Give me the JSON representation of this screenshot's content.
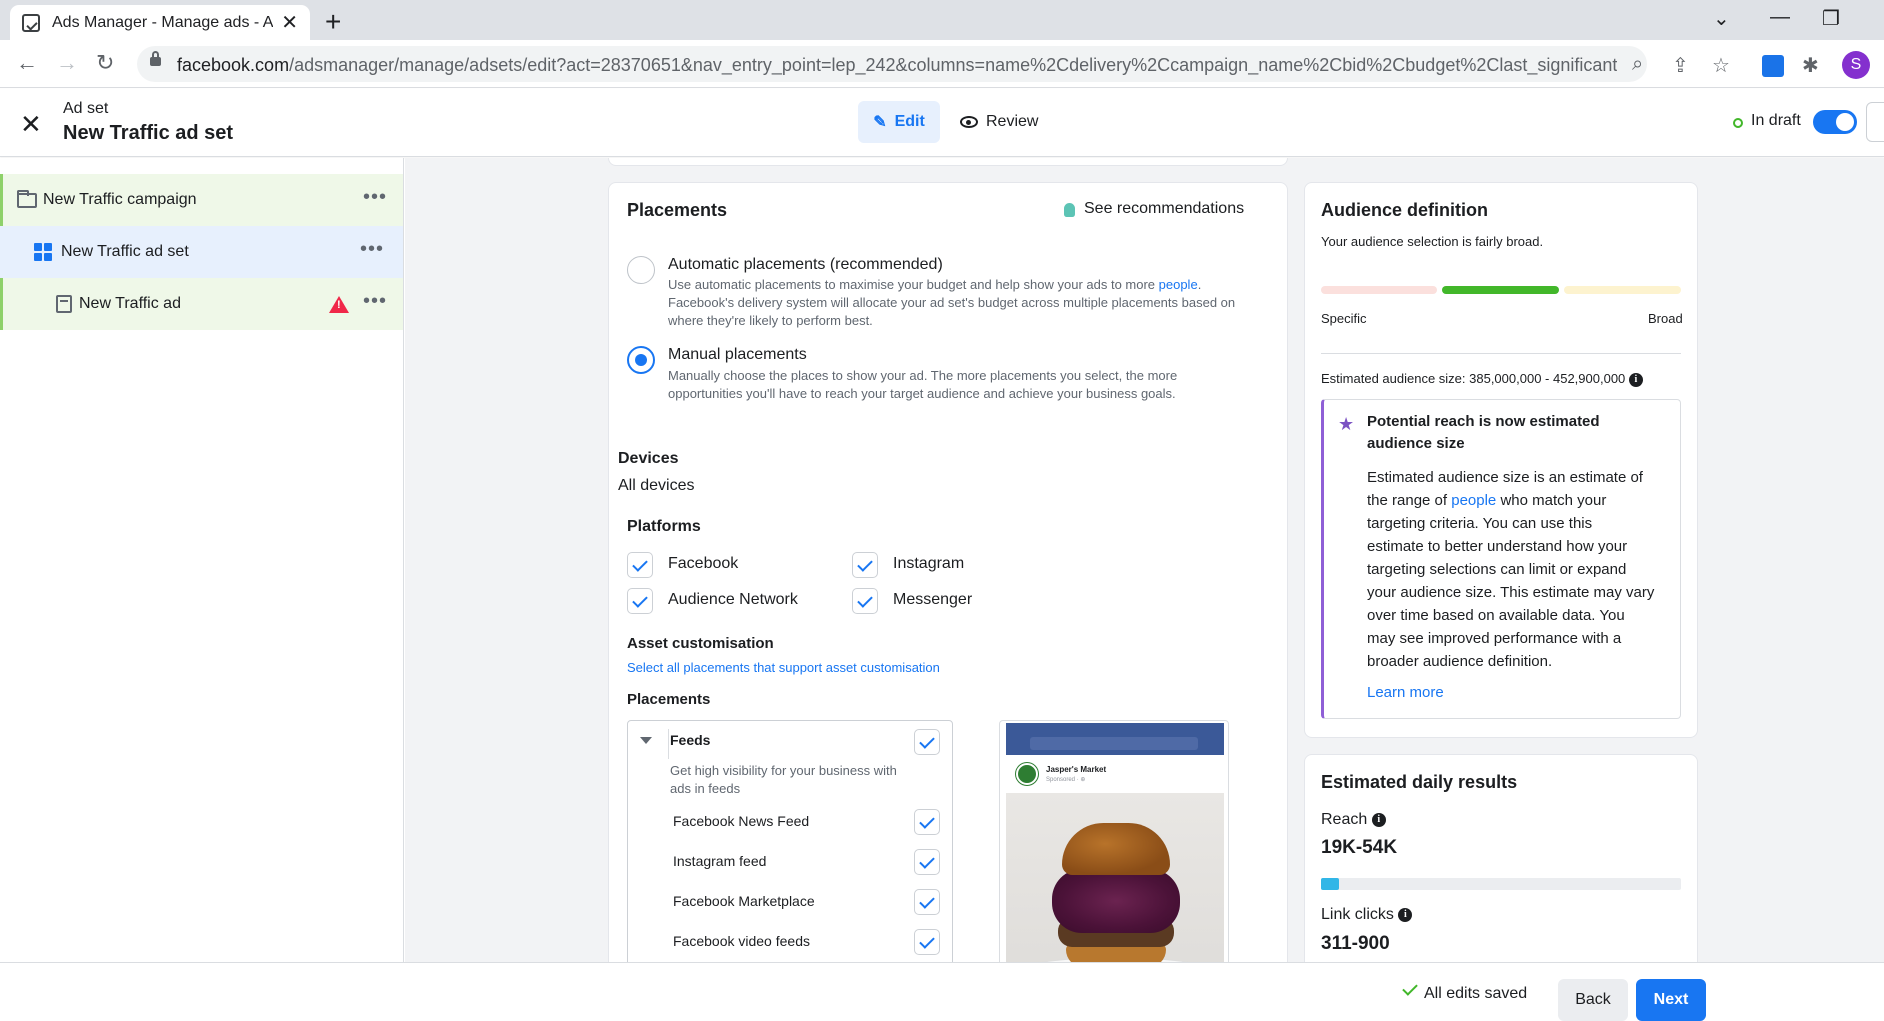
{
  "browser": {
    "tab_title": "Ads Manager - Manage ads - Ad",
    "tab_close": "✕",
    "new_tab": "+",
    "url_host": "facebook.com",
    "url_path": "/adsmanager/manage/adsets/edit?act=28370651&nav_entry_point=lep_242&columns=name%2Cdelivery%2Ccampaign_name%2Cbid%2Cbudget%2Clast_significant_edit...",
    "profile_initial": "S"
  },
  "header": {
    "close": "✕",
    "subtitle": "Ad set",
    "title": "New Traffic ad set",
    "edit_label": "Edit",
    "review_label": "Review",
    "status_label": "In draft"
  },
  "sidebar": {
    "items": [
      {
        "label": "New Traffic campaign",
        "type": "campaign"
      },
      {
        "label": "New Traffic ad set",
        "type": "adset"
      },
      {
        "label": "New Traffic ad",
        "type": "ad",
        "warning": true
      }
    ],
    "more": "•••"
  },
  "placements": {
    "title": "Placements",
    "see_recommendations": "See recommendations",
    "automatic": {
      "label": "Automatic placements (recommended)",
      "desc_1": "Use automatic placements to maximise your budget and help show your ads to more ",
      "desc_link": "people",
      "desc_2": ".",
      "desc_line2": "Facebook's delivery system will allocate your ad set's budget across multiple placements based on",
      "desc_line3": "where they're likely to perform best.",
      "selected": false
    },
    "manual": {
      "label": "Manual placements",
      "desc_line1": "Manually choose the places to show your ad. The more placements you select, the more",
      "desc_line2": "opportunities you'll have to reach your target audience and achieve your business goals.",
      "selected": true
    },
    "devices_label": "Devices",
    "devices_value": "All devices",
    "platforms_label": "Platforms",
    "platforms": [
      "Facebook",
      "Instagram",
      "Audience Network",
      "Messenger"
    ],
    "asset_label": "Asset customisation",
    "asset_link": "Select all placements that support asset customisation",
    "placements_label": "Placements",
    "feeds": {
      "label": "Feeds",
      "desc_line1": "Get high visibility for your business with",
      "desc_line2": "ads in feeds",
      "items": [
        "Facebook News Feed",
        "Instagram feed",
        "Facebook Marketplace",
        "Facebook video feeds"
      ]
    },
    "preview": {
      "page_name": "Jasper's Market",
      "sponsored": "Sponsored · ⊕"
    }
  },
  "audience": {
    "title": "Audience definition",
    "summary": "Your audience selection is fairly broad.",
    "specific": "Specific",
    "broad": "Broad",
    "estimated_size": "Estimated audience size: 385,000,000 - 452,900,000",
    "info": "i",
    "notice_title_1": "Potential reach is now estimated",
    "notice_title_2": "audience size",
    "notice_lines": [
      "Estimated audience size is an estimate of",
      "the range of ",
      "people",
      " who match your",
      "targeting criteria. You can use this",
      "estimate to better understand how your",
      "targeting selections can limit or expand",
      "your audience size. This estimate may vary",
      "over time based on available data. You",
      "may see improved performance with a",
      "broader audience definition."
    ],
    "learn_more": "Learn more",
    "meter_colors": {
      "left": "#fbe0dd",
      "mid": "#42b72a",
      "right": "#fdf3cf"
    }
  },
  "results": {
    "title": "Estimated daily results",
    "reach_label": "Reach",
    "reach_value": "19K-54K",
    "reach_fill": 0.05,
    "clicks_label": "Link clicks",
    "clicks_value": "311-900"
  },
  "footer": {
    "saved": "All edits saved",
    "back": "Back",
    "next": "Next"
  }
}
